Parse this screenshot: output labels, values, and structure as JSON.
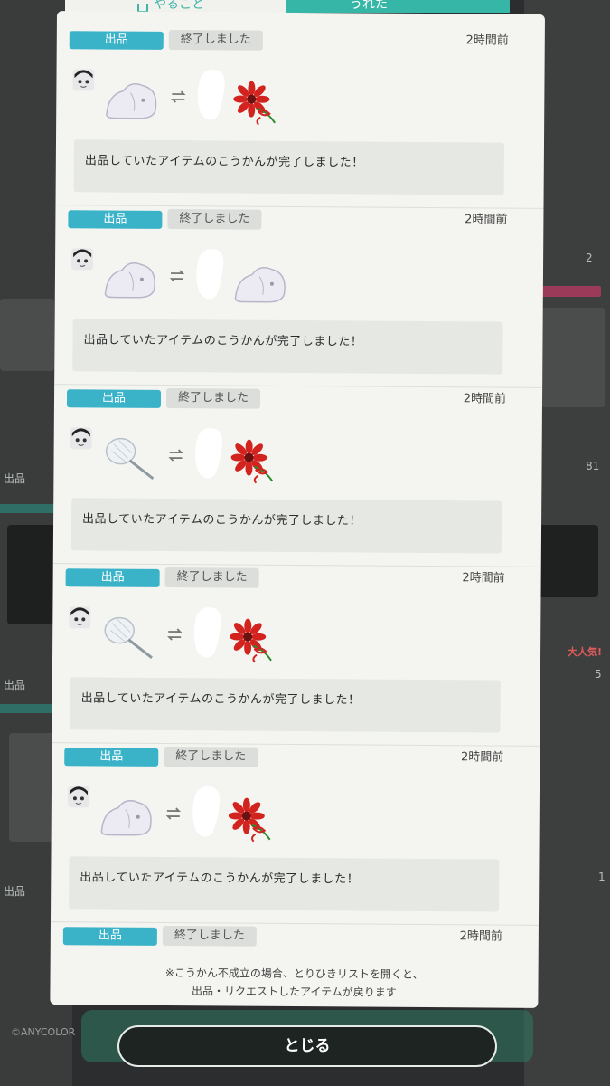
{
  "tabs": {
    "left_label": "やること",
    "right_label": "うれた"
  },
  "notifications": [
    {
      "type": "出品",
      "status": "終了しました",
      "time": "2時間前",
      "message": "出品していたアイテムのこうかんが完了しました！",
      "give_item": "ghost-plush-icon",
      "get_item": "red-flower-icon"
    },
    {
      "type": "出品",
      "status": "終了しました",
      "time": "2時間前",
      "message": "出品していたアイテムのこうかんが完了しました！",
      "give_item": "ghost-plush-icon",
      "get_item": "ghost-plush-icon"
    },
    {
      "type": "出品",
      "status": "終了しました",
      "time": "2時間前",
      "message": "出品していたアイテムのこうかんが完了しました！",
      "give_item": "feather-duster-icon",
      "get_item": "red-flower-icon"
    },
    {
      "type": "出品",
      "status": "終了しました",
      "time": "2時間前",
      "message": "出品していたアイテムのこうかんが完了しました！",
      "give_item": "feather-duster-icon",
      "get_item": "red-flower-icon"
    },
    {
      "type": "出品",
      "status": "終了しました",
      "time": "2時間前",
      "message": "出品していたアイテムのこうかんが完了しました！",
      "give_item": "ghost-plush-icon",
      "get_item": "red-flower-icon"
    },
    {
      "type": "出品",
      "status": "終了しました",
      "time": "2時間前"
    }
  ],
  "note_line1": "※こうかん不成立の場合、とりひきリストを開くと、",
  "note_line2": "出品・リクエストしたアイテムが戻ります",
  "close_label": "とじる",
  "background": {
    "brand": "©ANYCOLOR",
    "counts": [
      "2",
      "81",
      "5",
      "1"
    ],
    "popular_badge": "大人気!",
    "labels": [
      "出品",
      "出品",
      "出品",
      "出品"
    ]
  },
  "colors": {
    "accent": "#3ab2c8",
    "dialog_bg": "#f4f5f1",
    "tab_teal": "#36b6a6"
  }
}
